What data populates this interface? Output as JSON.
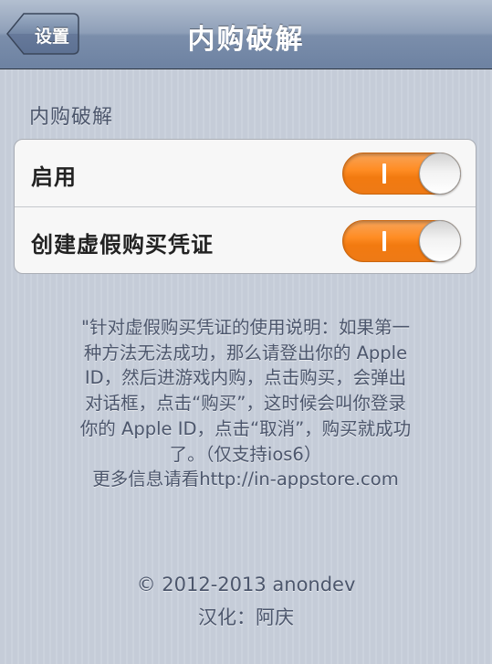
{
  "navbar": {
    "title": "内购破解",
    "back_label": "设置"
  },
  "section": {
    "header": "内购破解"
  },
  "settings": [
    {
      "label": "启用",
      "on": true
    },
    {
      "label": "创建虚假购买凭证",
      "on": true
    }
  ],
  "colors": {
    "switch_on": "#ff8d24",
    "navbar": "#8e9fb8",
    "text": "#4c566c"
  },
  "description_lines": [
    "\"针对虚假购买凭证的使用说明：如果第一",
    "种方法无法成功，那么请登出你的 Apple",
    "ID，然后进游戏内购，点击购买，会弹出",
    "对话框，点击“购买”，这时候会叫你登录",
    "你的 Apple ID，点击“取消”，购买就成功",
    "了。（仅支持ios6）",
    "更多信息请看http://in-appstore.com"
  ],
  "footer": {
    "copyright": "© 2012-2013 anondev",
    "translator": "汉化：阿庆"
  }
}
